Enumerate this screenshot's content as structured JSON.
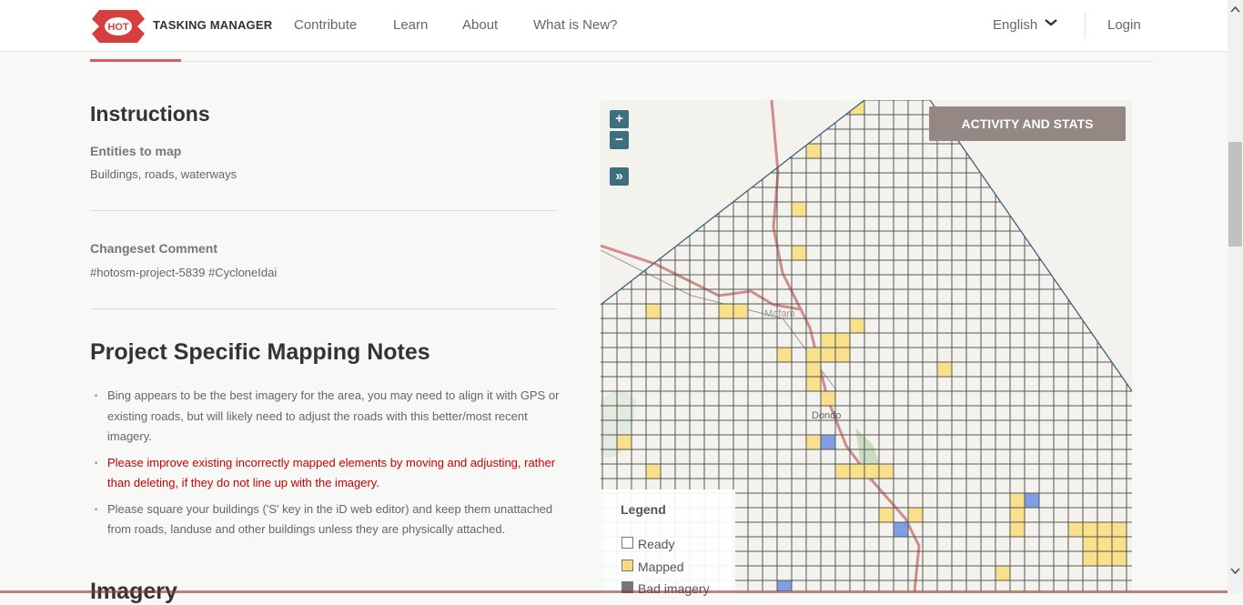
{
  "header": {
    "logo_text": "HOT",
    "brand": "TASKING MANAGER",
    "nav": [
      "Contribute",
      "Learn",
      "About",
      "What is New?"
    ],
    "language": "English",
    "login": "Login",
    "accent_color": "#d73f3f"
  },
  "instructions": {
    "title": "Instructions",
    "entities_label": "Entities to map",
    "entities_value": "Buildings, roads, waterways",
    "changeset_label": "Changeset Comment",
    "changeset_value": "#hotosm-project-5839 #CycloneIdai"
  },
  "notes": {
    "title": "Project Specific Mapping Notes",
    "items": [
      {
        "text": "Bing appears to be the best imagery for the area, you may need to align it with GPS or existing roads, but will likely need to adjust the roads with this better/most recent imagery.",
        "highlight": false
      },
      {
        "text": "Please improve existing incorrectly mapped elements by moving and adjusting, rather than deleting, if they do not line up with the imagery.",
        "highlight": true
      },
      {
        "text": "Please square your buildings ('S' key in the iD web editor) and keep them unattached from roads, landuse and other buildings unless they are physically attached.",
        "highlight": false
      }
    ],
    "next_heading": "Imagery"
  },
  "map": {
    "zoom_in": "+",
    "zoom_out": "−",
    "expand": "»",
    "activity_button": "ACTIVITY AND STATS",
    "place_labels": [
      "Mafam",
      "Dondo"
    ],
    "legend": {
      "title": "Legend",
      "items": [
        {
          "label": "Ready",
          "color": "#ffffff"
        },
        {
          "label": "Mapped",
          "color": "#fad980"
        },
        {
          "label": "Bad imagery",
          "color": "#777777"
        }
      ]
    },
    "colors": {
      "mapped": "#f9e08a",
      "validated": "#7f9ee6",
      "grid": "#555555",
      "aoi_border": "#3b6378"
    }
  }
}
